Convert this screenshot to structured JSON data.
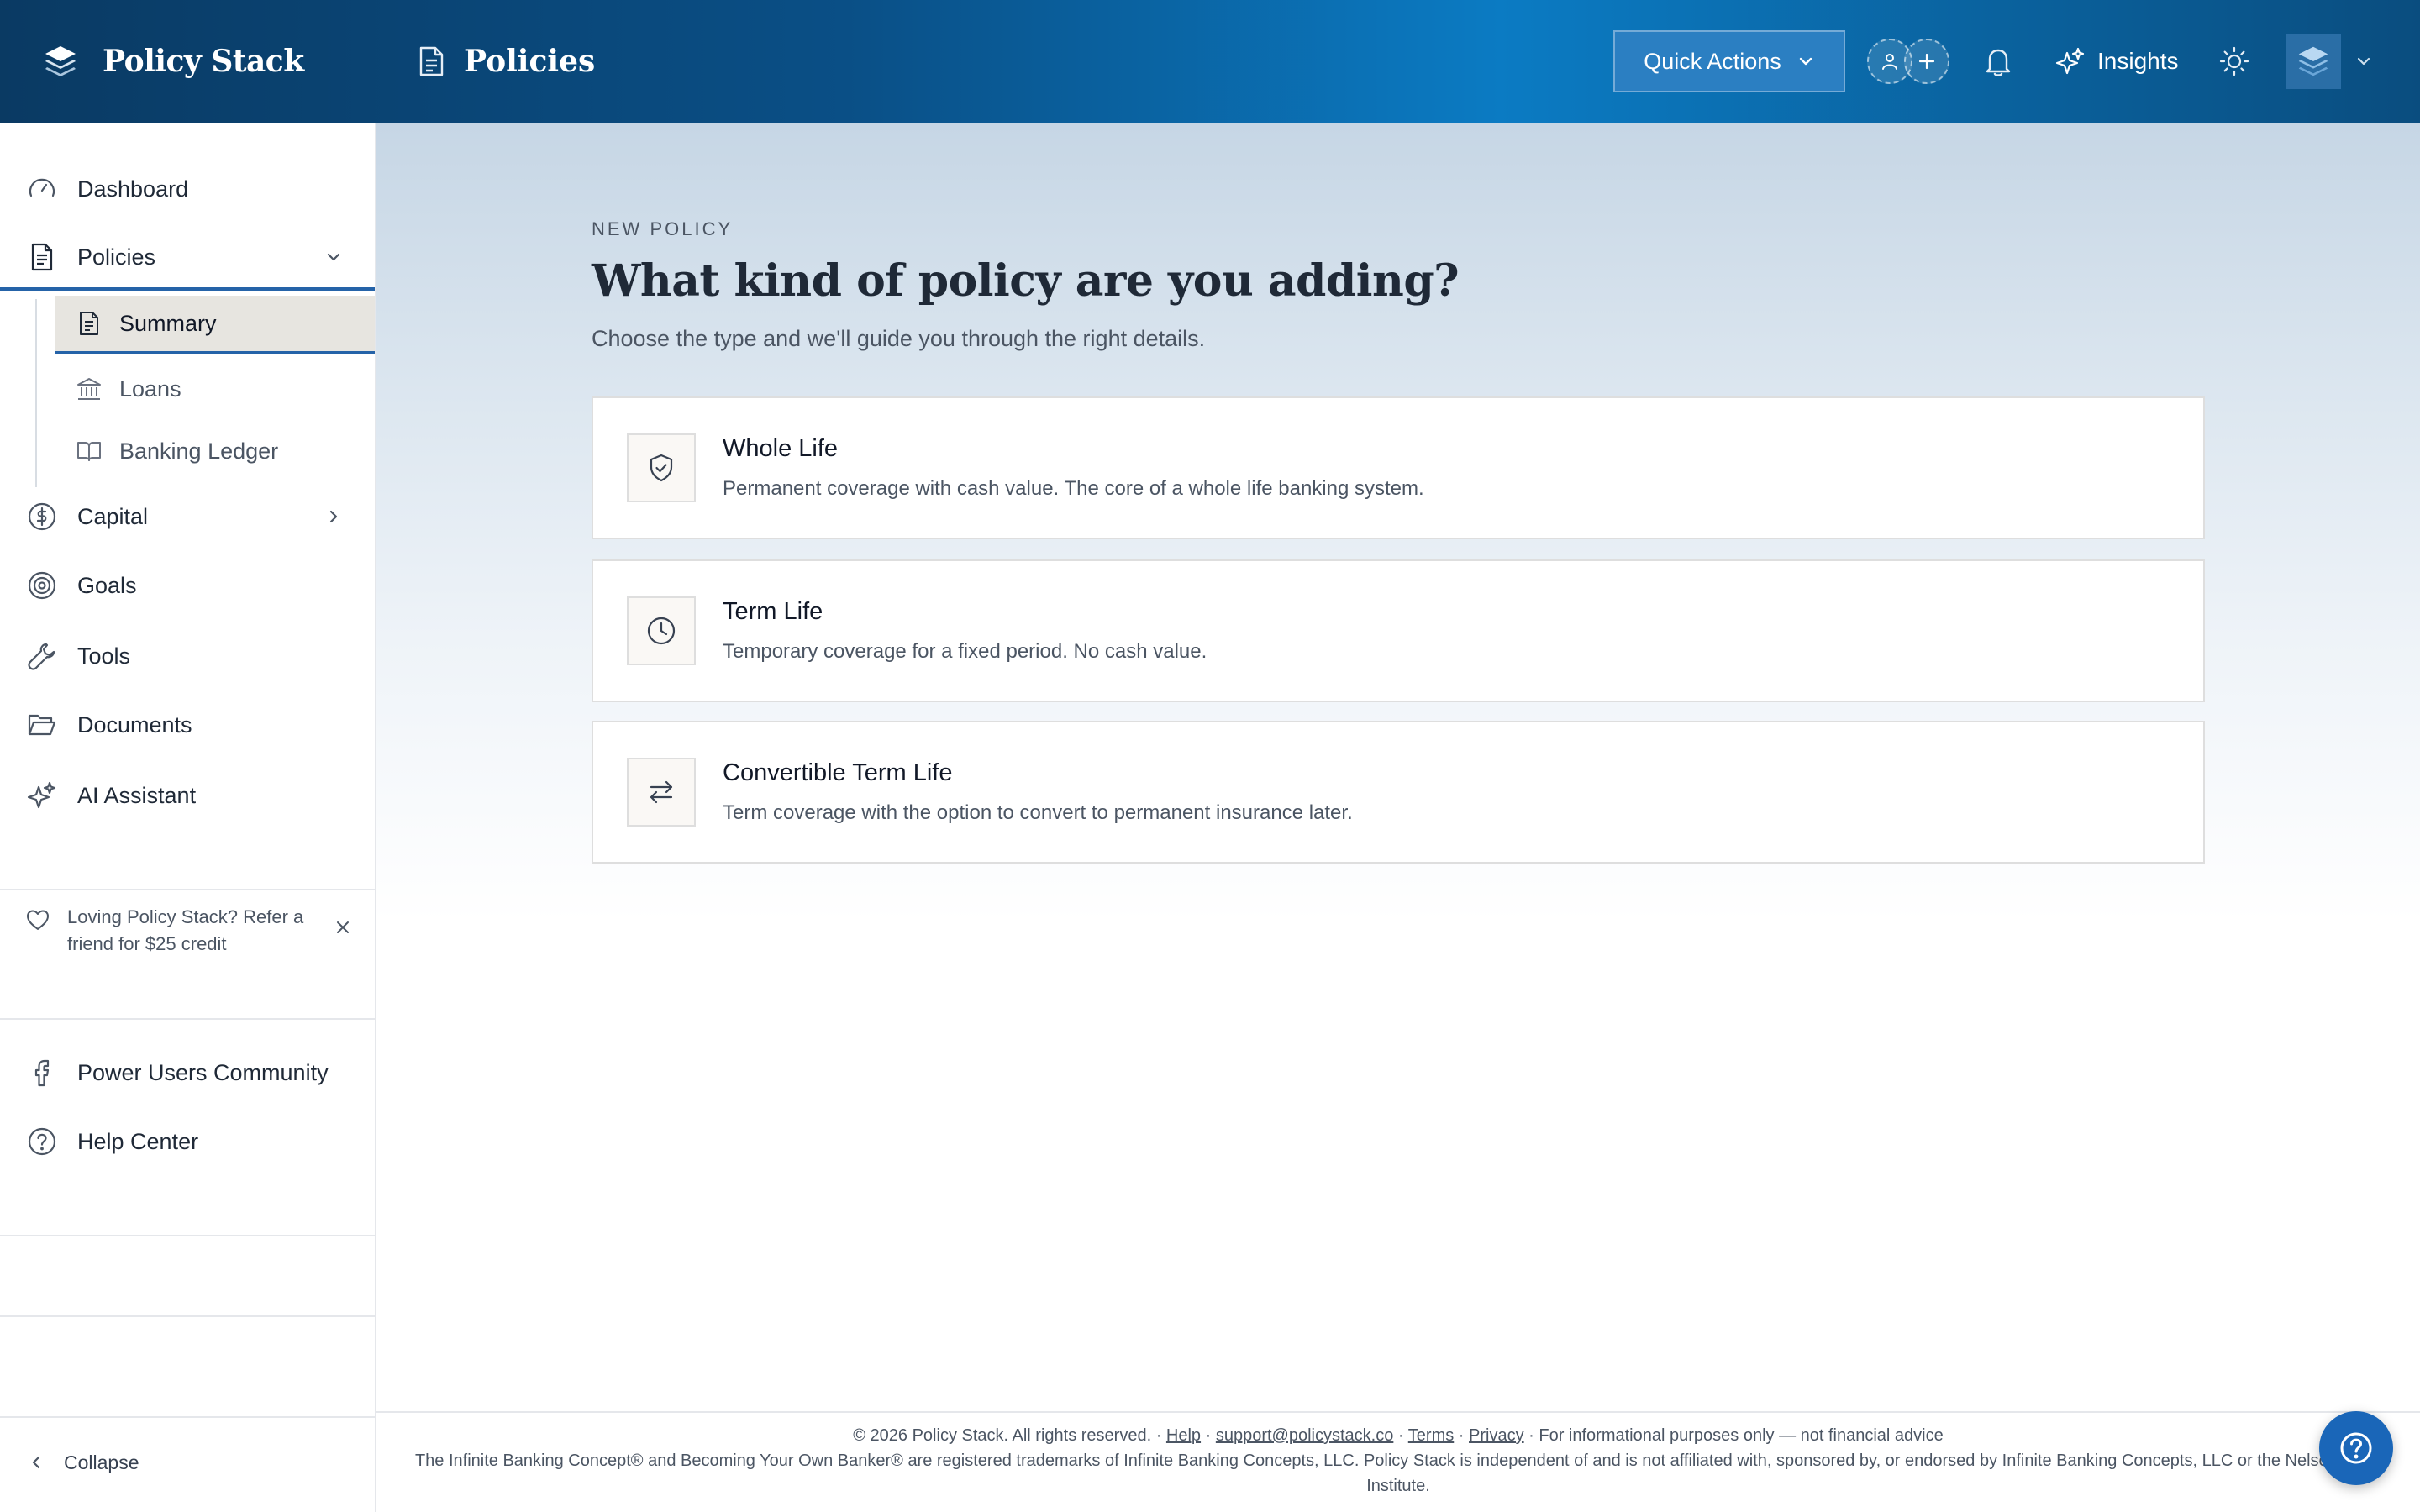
{
  "brand": {
    "name": "Policy Stack"
  },
  "header": {
    "page_title": "Policies",
    "quick_actions_label": "Quick Actions",
    "insights_label": "Insights"
  },
  "sidebar": {
    "items": {
      "dashboard": "Dashboard",
      "policies": "Policies",
      "summary": "Summary",
      "loans": "Loans",
      "banking_ledger": "Banking Ledger",
      "capital": "Capital",
      "goals": "Goals",
      "tools": "Tools",
      "documents": "Documents",
      "ai_assistant": "AI Assistant"
    },
    "active_subitem": "Summary",
    "referral_text": "Loving Policy Stack? Refer a friend for $25 credit",
    "community_label": "Power Users Community",
    "help_center_label": "Help Center",
    "collapse_label": "Collapse"
  },
  "main": {
    "eyebrow": "NEW POLICY",
    "title": "What kind of policy are you adding?",
    "subtitle": "Choose the type and we'll guide you through the right details.",
    "options": [
      {
        "title": "Whole Life",
        "description": "Permanent coverage with cash value. The core of a whole life banking system.",
        "icon": "shield-check-icon"
      },
      {
        "title": "Term Life",
        "description": "Temporary coverage for a fixed period. No cash value.",
        "icon": "clock-icon"
      },
      {
        "title": "Convertible Term Life",
        "description": "Term coverage with the option to convert to permanent insurance later.",
        "icon": "arrows-swap-icon"
      }
    ]
  },
  "footer": {
    "copyright": "© 2026 Policy Stack. All rights reserved. ·",
    "help_link": "Help",
    "email_link": "support@policystack.co",
    "terms_link": "Terms",
    "privacy_link": "Privacy",
    "disclaimer": "· For informational purposes only — not financial advice",
    "trademark": "The Infinite Banking Concept® and Becoming Your Own Banker® are registered trademarks of Infinite Banking Concepts, LLC. Policy Stack is independent of and is not affiliated with, sponsored by, or endorsed by Infinite Banking Concepts, LLC or the Nelson Nash Institute."
  },
  "colors": {
    "header_gradient_start": "#0a3a63",
    "header_gradient_mid": "#0b7bc3",
    "accent": "#2563a8",
    "active_bg": "#e7e5e0",
    "help_button": "#1a66b8"
  }
}
